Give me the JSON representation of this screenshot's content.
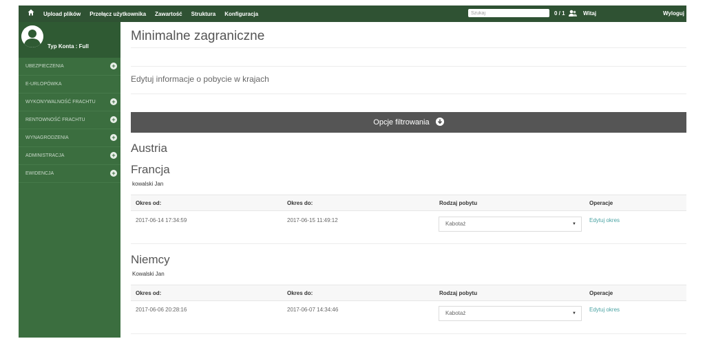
{
  "topbar": {
    "nav": [
      "Upload plików",
      "Przełącz użytkownika",
      "Zawartość",
      "Struktura",
      "Konfiguracja"
    ],
    "search_placeholder": "Szukaj",
    "counter": "0 / 1",
    "welcome": "Witaj",
    "logout": "Wyloguj"
  },
  "sidebar": {
    "account_type": "Typ Konta : Full",
    "items": [
      {
        "label": "UBEZPIECZENIA",
        "expandable": true
      },
      {
        "label": "E-URLOPÓWKA",
        "expandable": false
      },
      {
        "label": "WYKONYWALNOŚĆ FRACHTU",
        "expandable": true
      },
      {
        "label": "RENTOWNOŚĆ FRACHTU",
        "expandable": true
      },
      {
        "label": "WYNAGRODZENIA",
        "expandable": true
      },
      {
        "label": "ADMINISTRACJA",
        "expandable": true
      },
      {
        "label": "EWIDENCJA",
        "expandable": true
      }
    ]
  },
  "main": {
    "title": "Minimalne zagraniczne",
    "subtitle": "Edytuj informacje o pobycie w krajach",
    "filter_label": "Opcje filtrowania",
    "columns": [
      "Okres od:",
      "Okres do:",
      "Rodzaj pobytu",
      "Operacje"
    ],
    "countries": [
      {
        "name": "Austria"
      },
      {
        "name": "Francja",
        "person": "kowalski Jan",
        "row": {
          "from": "2017-06-14 17:34:59",
          "to": "2017-06-15 11:49:12",
          "type": "Kabotaż",
          "action": "Edytuj okres"
        }
      },
      {
        "name": "Niemcy",
        "person": "Kowalski Jan",
        "row": {
          "from": "2017-06-06 20:28:16",
          "to": "2017-06-07 14:34:46",
          "type": "Kabotaż",
          "action": "Edytuj okres"
        }
      }
    ]
  },
  "colors": {
    "topbar": "#2f5233",
    "sidebar": "#3b6e3f",
    "filterbar": "#555555",
    "link": "#4aa3a3"
  }
}
